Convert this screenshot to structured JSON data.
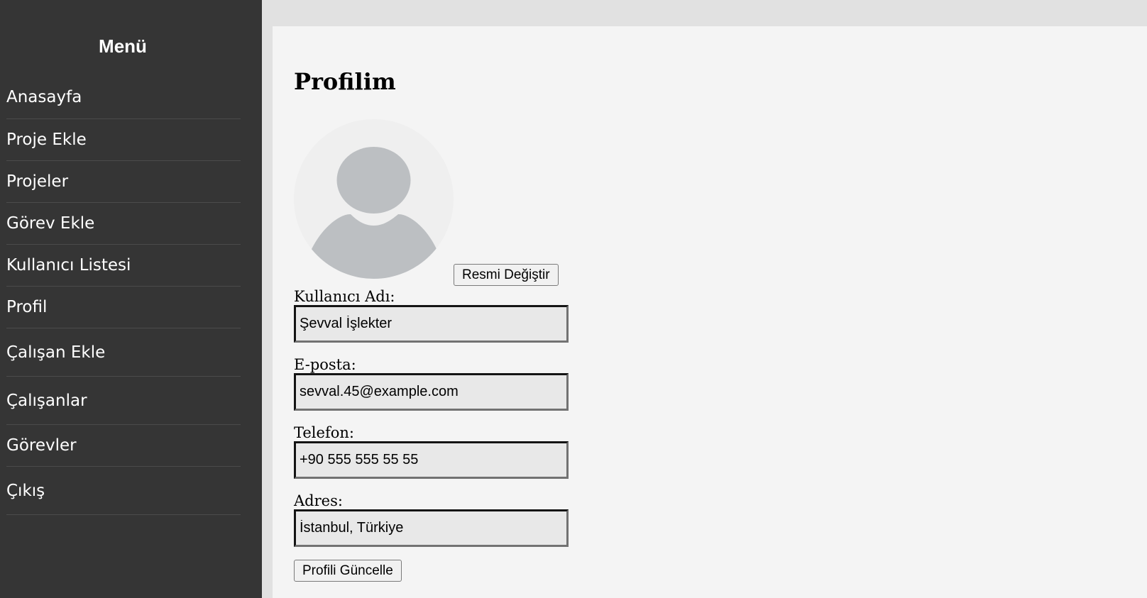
{
  "sidebar": {
    "title": "Menü",
    "items": [
      {
        "label": "Anasayfa"
      },
      {
        "label": "Proje Ekle"
      },
      {
        "label": "Projeler"
      },
      {
        "label": "Görev Ekle"
      },
      {
        "label": "Kullanıcı Listesi"
      },
      {
        "label": "Profil"
      },
      {
        "label": "Çalışan Ekle"
      },
      {
        "label": "Çalışanlar"
      },
      {
        "label": "Görevler"
      },
      {
        "label": "Çıkış"
      }
    ]
  },
  "profile": {
    "title": "Profilim",
    "change_photo_label": "Resmi Değiştir",
    "fields": [
      {
        "label": "Kullanıcı Adı:",
        "value": "Şevval İşlekter"
      },
      {
        "label": "E-posta:",
        "value": "sevval.45@example.com"
      },
      {
        "label": "Telefon:",
        "value": "+90 555 555 55 55"
      },
      {
        "label": "Adres:",
        "value": "İstanbul, Türkiye"
      }
    ],
    "update_label": "Profili Güncelle"
  },
  "colors": {
    "sidebar_bg": "#353535",
    "page_bg": "#e1e1e1",
    "panel_bg": "#f4f4f4",
    "avatar_fill": "#bcbfc2",
    "avatar_bg": "#efefef",
    "input_bg": "#e8e8e8"
  },
  "icons": {
    "avatar": "user-silhouette-icon"
  }
}
